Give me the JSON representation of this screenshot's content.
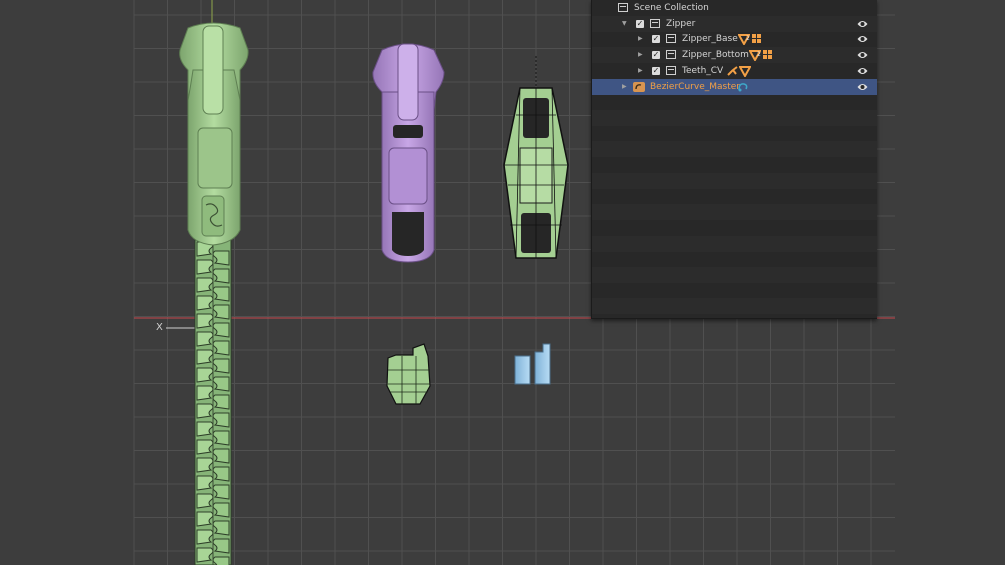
{
  "colors": {
    "background": "#3d3d3d",
    "grid_line": "#505050",
    "x_axis": "#c6474d",
    "y_axis": "#8fa64a",
    "zipper_green": "#a4cf92",
    "zipper_purple": "#b896d6",
    "selected_accent": "#f2a046",
    "blue_object": "#9fc8e8"
  },
  "viewport": {
    "axis_x_label": "X",
    "objects": [
      "zipper-teeth-chain",
      "zipper-slider-green",
      "zipper-slider-purple",
      "zipper-slider-wireframe",
      "tooth-piece-green",
      "tooth-stops-blue"
    ]
  },
  "outliner": {
    "rows": [
      {
        "label": "Scene Collection",
        "icon": "collection-icon",
        "eye": false,
        "checkbox": false,
        "expand": ""
      },
      {
        "label": "Zipper",
        "icon": "collection-icon",
        "eye": true,
        "checkbox": true,
        "expand": "open"
      },
      {
        "label": "Zipper_Base",
        "icon": "collection-icon",
        "eye": true,
        "checkbox": true,
        "expand": "closed",
        "badges": [
          "modifier-icon",
          "mesh-grid-icon"
        ],
        "badge_count": "2"
      },
      {
        "label": "Zipper_Bottom",
        "icon": "collection-icon",
        "eye": true,
        "checkbox": true,
        "expand": "closed",
        "badges": [
          "modifier-icon",
          "mesh-grid-icon"
        ],
        "badge_count": "2"
      },
      {
        "label": "Teeth_CV",
        "icon": "collection-icon",
        "eye": true,
        "checkbox": true,
        "expand": "closed",
        "badges": [
          "armature-icon",
          "modifier-icon"
        ]
      },
      {
        "label": "BezierCurve_Master",
        "icon": "curve-object-icon",
        "eye": true,
        "checkbox": false,
        "expand": "closed",
        "selected": true,
        "badges": [
          "curve-data-icon"
        ]
      }
    ]
  }
}
